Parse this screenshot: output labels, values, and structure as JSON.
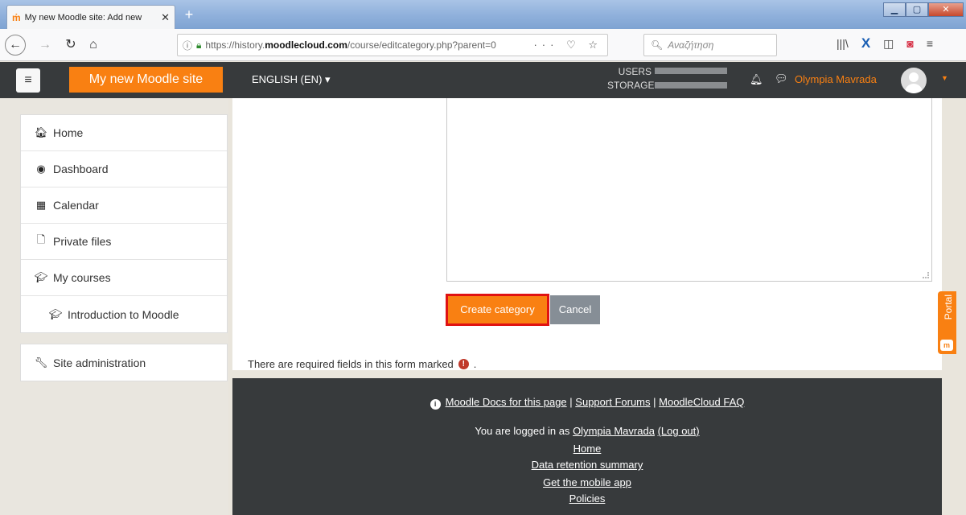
{
  "browser": {
    "tab_title": "My new Moodle site: Add new",
    "tab_favicon": "ṁ",
    "url": "https://history.moodlecloud.com/course/editcategory.php?parent=0",
    "url_prefix": "https://history.",
    "url_domain": "moodlecloud.com",
    "url_path": "/course/editcategory.php?parent=0",
    "search_placeholder": "Αναζήτηση",
    "url_actions": "··· ♡ ☆"
  },
  "header": {
    "site_name": "My new Moodle site",
    "language": "ENGLISH (EN)",
    "usage_users": "USERS",
    "usage_storage": "STORAGE",
    "username": "Olympia Mavrada"
  },
  "nav": {
    "items": [
      {
        "label": "Home",
        "icon": "home-icon"
      },
      {
        "label": "Dashboard",
        "icon": "dashboard-icon"
      },
      {
        "label": "Calendar",
        "icon": "calendar-icon"
      },
      {
        "label": "Private files",
        "icon": "file-icon"
      },
      {
        "label": "My courses",
        "icon": "graduation-cap-icon"
      },
      {
        "label": "Introduction to Moodle",
        "icon": "graduation-cap-icon"
      }
    ],
    "admin": {
      "label": "Site administration",
      "icon": "wrench-icon"
    }
  },
  "form": {
    "create_label": "Create category",
    "cancel_label": "Cancel",
    "required_text": "There are required fields in this form marked",
    "required_suffix": "."
  },
  "portal_label": "Portal",
  "footer": {
    "docs_link": "Moodle Docs for this page",
    "forums_link": "Support Forums",
    "faq_link": "MoodleCloud FAQ",
    "separator": "|",
    "logged_in_prefix": "You are logged in as",
    "logged_in_user": "Olympia Mavrada",
    "logout_label": "(Log out)",
    "home_link": "Home",
    "retention_link": "Data retention summary",
    "mobile_link": "Get the mobile app",
    "policies_link": "Policies"
  },
  "colors": {
    "brand": "#f98012",
    "header_bg": "#373a3c",
    "highlight": "#e01212",
    "cancel_bg": "#868e96"
  }
}
